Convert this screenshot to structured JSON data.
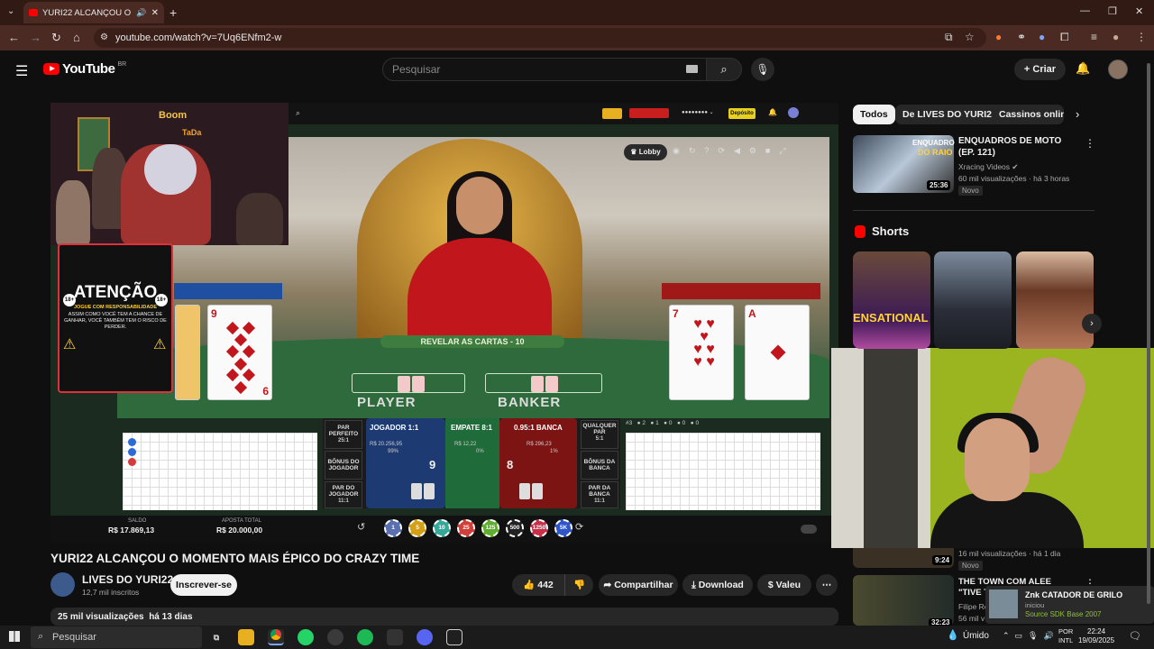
{
  "browser": {
    "tab_title": "YURI22 ALCANÇOU O MOM",
    "url": "youtube.com/watch?v=7Uq6ENfm2-w"
  },
  "youtube": {
    "logo": "YouTube",
    "country": "BR",
    "search_placeholder": "Pesquisar",
    "create_label": "Criar"
  },
  "video": {
    "title": "YURI22 ALCANÇOU O MOMENTO MAIS ÉPICO DO CRAZY TIME",
    "channel": "LIVES DO YURI22",
    "subscribers": "12,7 mil inscritos",
    "subscribe_label": "Inscrever-se",
    "likes": "442",
    "share_label": "Compartilhar",
    "download_label": "Download",
    "thanks_label": "Valeu",
    "views": "25 mil visualizações",
    "age": "há 13 dias"
  },
  "game": {
    "studio_sign": "Boom",
    "studio_sign2": "TaDa",
    "warning_title": "ATENÇÃO",
    "warning_line1": "JOGUE COM RESPONSABILIDADE",
    "warning_line2": "ASSIM COMO VOCÊ TEM A CHANCE DE GANHAR, VOCÊ TAMBÉM TEM O RISCO DE PERDER.",
    "lobby": "Lobby",
    "deposit": "Depósito",
    "reveal": "REVELAR AS CARTAS - 10",
    "player_label": "PLAYER",
    "banker_label": "BANKER",
    "par_perfeito": "PAR PERFEITO",
    "par_perfeito_odds": "25:1",
    "bonus_jogador": "BÔNUS DO JOGADOR",
    "par_jogador": "PAR DO JOGADOR",
    "par_jogador_odds": "11:1",
    "jogador": "JOGADOR 1:1",
    "jogador_total": "R$ 20.256,95",
    "jogador_pct": "99%",
    "jogador_score": "9",
    "empate": "EMPATE 8:1",
    "empate_total": "R$ 12,22",
    "empate_pct": "0%",
    "banca": "0.95:1 BANCA",
    "banca_total": "R$ 296,23",
    "banca_pct": "1%",
    "banca_score": "8",
    "qualquer_par": "QUALQUER PAR",
    "qualquer_par_odds": "5:1",
    "bonus_banca": "BÔNUS DA BANCA",
    "par_banca": "PAR DA BANCA",
    "par_banca_odds": "11:1",
    "saldo_label": "SALDO",
    "saldo": "R$ 17.869,13",
    "aposta_label": "APOSTA TOTAL",
    "aposta": "R$ 20.000,00",
    "chips": [
      "1",
      "5",
      "10",
      "25",
      "125",
      "500",
      "1250",
      "5K"
    ],
    "chip_colors": [
      "#5a6fb0",
      "#d4a017",
      "#36a89a",
      "#d0403a",
      "#5fae2e",
      "#222222",
      "#c8304a",
      "#2f55c9"
    ],
    "player_cards": [
      "9",
      "6"
    ],
    "banker_cards": [
      "7",
      "A"
    ]
  },
  "sidebar": {
    "chips": [
      "Todos",
      "De LIVES DO YURI22",
      "Cassinos online"
    ],
    "video1": {
      "title": "ENQUADROS DE MOTO (EP. 121)",
      "channel": "Xracing Videos",
      "stats": "60 mil visualizações · há 3 horas",
      "badge": "Novo",
      "duration": "25:36",
      "thumb_text1": "ENQUADRO",
      "thumb_text2": "DO RAIO"
    },
    "shorts_label": "Shorts",
    "video3": {
      "stats": "16 mil visualizações · há 1 dia",
      "badge": "Novo",
      "duration": "9:24"
    },
    "video4": {
      "title": "THE TOWN COM ALEE \"TIVE TODAS",
      "channel": "Filipe Re",
      "stats": "56 mil v",
      "duration": "32:23"
    }
  },
  "notification": {
    "title": "Znk CATADOR DE GRILO",
    "status": "iniciou",
    "game": "Source SDK Base 2007"
  },
  "taskbar": {
    "search": "Pesquisar",
    "weather": "Úmido",
    "lang1": "POR",
    "lang2": "INTL",
    "time": "22:24",
    "date": "19/09/2025"
  }
}
